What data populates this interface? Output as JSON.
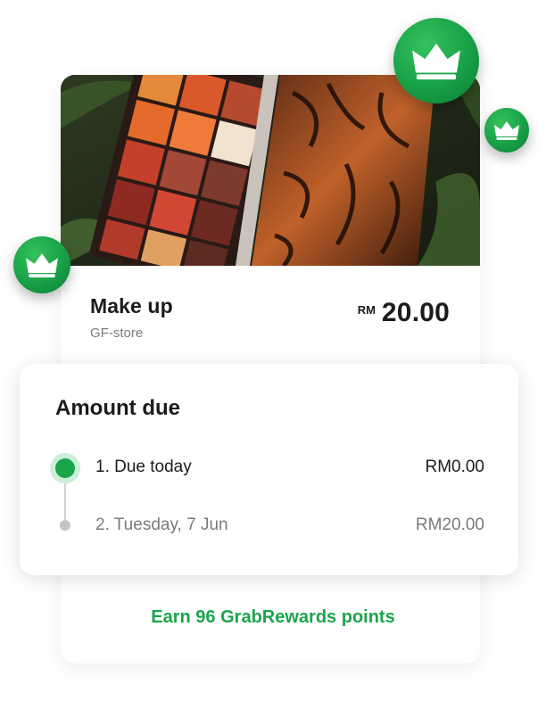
{
  "product": {
    "name": "Make up",
    "store": "GF-store",
    "price_currency": "RM",
    "price_amount": "20.00"
  },
  "amount_due": {
    "title": "Amount due",
    "installments": [
      {
        "label": "1. Due today",
        "amount": "RM0.00",
        "status": "active"
      },
      {
        "label": "2. Tuesday, 7 Jun",
        "amount": "RM20.00",
        "status": "upcoming"
      }
    ]
  },
  "rewards": {
    "text": "Earn 96 GrabRewards points"
  },
  "colors": {
    "brand_green": "#1aa64a",
    "text_dark": "#1c1c1c",
    "text_muted": "#7a7a7a"
  },
  "icons": {
    "badge": "crown-icon"
  }
}
